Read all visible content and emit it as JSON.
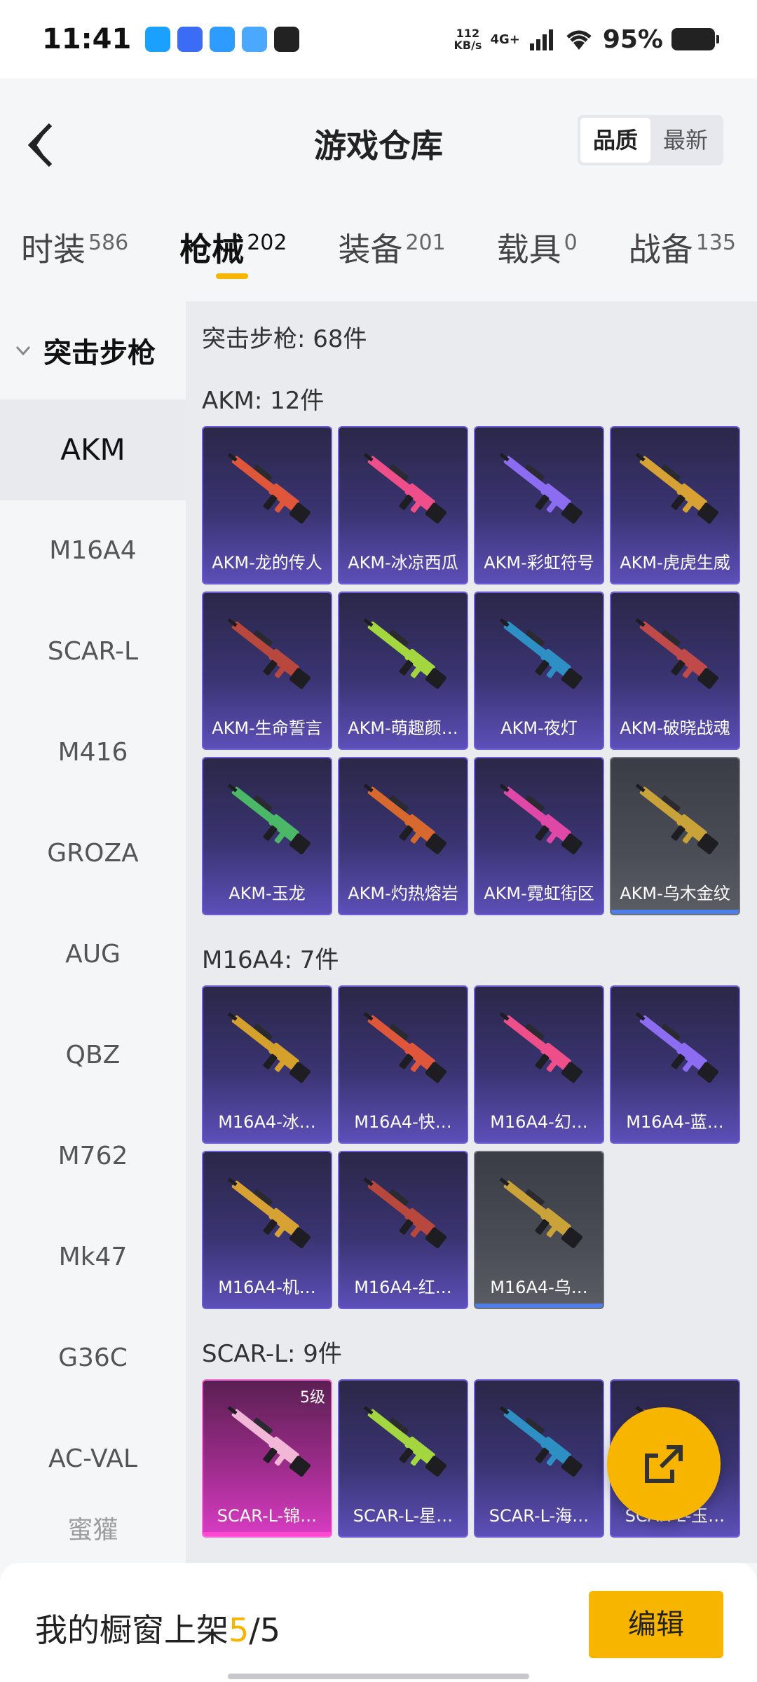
{
  "status": {
    "time": "11:41",
    "speed_num": "112",
    "speed_unit": "KB/s",
    "network": "4G+",
    "battery": "95%",
    "app_icons": [
      {
        "name": "messages-app-icon",
        "color": "#1aa0ff"
      },
      {
        "name": "vivo-app-icon",
        "color": "#3b6cf5"
      },
      {
        "name": "browser-app-icon",
        "color": "#2e9bff"
      },
      {
        "name": "files-app-icon",
        "color": "#4aa8ff"
      },
      {
        "name": "qq-app-icon",
        "color": "#222222"
      }
    ]
  },
  "header": {
    "title": "游戏仓库",
    "sort_options": [
      "品质",
      "最新"
    ],
    "sort_active": "品质"
  },
  "tabs": [
    {
      "label": "时装",
      "count": "586"
    },
    {
      "label": "枪械",
      "count": "202",
      "active": true
    },
    {
      "label": "装备",
      "count": "201"
    },
    {
      "label": "载具",
      "count": "0"
    },
    {
      "label": "战备",
      "count": "135"
    }
  ],
  "sidebar": {
    "category": "突击步枪",
    "items": [
      "AKM",
      "M16A4",
      "SCAR-L",
      "M416",
      "GROZA",
      "AUG",
      "QBZ",
      "M762",
      "Mk47",
      "G36C",
      "AC-VAL",
      "蜜獾"
    ],
    "active": "AKM"
  },
  "content": {
    "total": "突击步枪: 68件",
    "groups": [
      {
        "title": "AKM: 12件",
        "items": [
          {
            "name": "AKM-龙的传人",
            "style": "purple"
          },
          {
            "name": "AKM-冰凉西瓜",
            "style": "purple"
          },
          {
            "name": "AKM-彩虹符号",
            "style": "purple"
          },
          {
            "name": "AKM-虎虎生威",
            "style": "purple"
          },
          {
            "name": "AKM-生命誓言",
            "style": "purple"
          },
          {
            "name": "AKM-萌趣颜…",
            "style": "purple"
          },
          {
            "name": "AKM-夜灯",
            "style": "purple"
          },
          {
            "name": "AKM-破晓战魂",
            "style": "purple"
          },
          {
            "name": "AKM-玉龙",
            "style": "purple"
          },
          {
            "name": "AKM-灼热熔岩",
            "style": "purple"
          },
          {
            "name": "AKM-霓虹街区",
            "style": "purple"
          },
          {
            "name": "AKM-乌木金纹",
            "style": "grey"
          }
        ]
      },
      {
        "title": "M16A4: 7件",
        "items": [
          {
            "name": "M16A4-冰…",
            "style": "purple"
          },
          {
            "name": "M16A4-快…",
            "style": "purple"
          },
          {
            "name": "M16A4-幻…",
            "style": "purple"
          },
          {
            "name": "M16A4-蓝…",
            "style": "purple"
          },
          {
            "name": "M16A4-机…",
            "style": "purple"
          },
          {
            "name": "M16A4-红…",
            "style": "purple"
          },
          {
            "name": "M16A4-乌…",
            "style": "grey"
          }
        ]
      },
      {
        "title": "SCAR-L: 9件",
        "items": [
          {
            "name": "SCAR-L-锦…",
            "style": "pink",
            "level": "5级"
          },
          {
            "name": "SCAR-L-星…",
            "style": "purple"
          },
          {
            "name": "SCAR-L-海…",
            "style": "purple"
          },
          {
            "name": "SCAR-L-玉…",
            "style": "purple"
          }
        ]
      }
    ]
  },
  "bottom": {
    "label": "我的橱窗上架",
    "current": "5",
    "total": "/5",
    "edit_label": "编辑"
  },
  "accent_color": "#f7b500"
}
